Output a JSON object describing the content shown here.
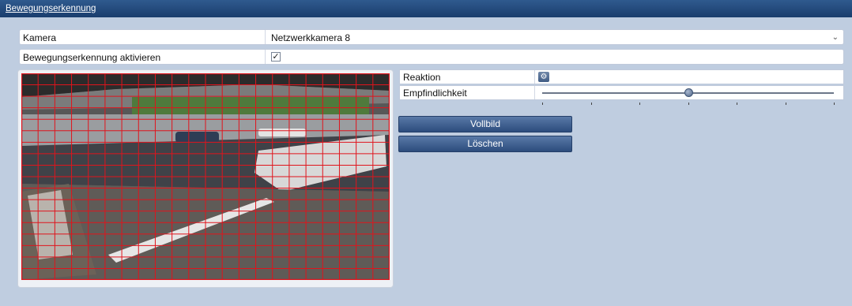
{
  "window": {
    "title": "Bewegungserkennung"
  },
  "camera": {
    "label": "Kamera",
    "value": "Netzwerkkamera 8"
  },
  "motion_enable": {
    "label": "Bewegungserkennung aktivieren",
    "checked": true,
    "check_glyph": "✓"
  },
  "settings": {
    "reaction_label": "Reaktion",
    "reaction_icon": "gear-icon",
    "sensitivity_label": "Empfindlichkeit",
    "sensitivity_level": 0.5
  },
  "buttons": {
    "fullscreen": "Vollbild",
    "delete": "Löschen"
  },
  "colors": {
    "grid": "#e0141c",
    "title_bar": "#1f4475",
    "background": "#bfcde0"
  }
}
